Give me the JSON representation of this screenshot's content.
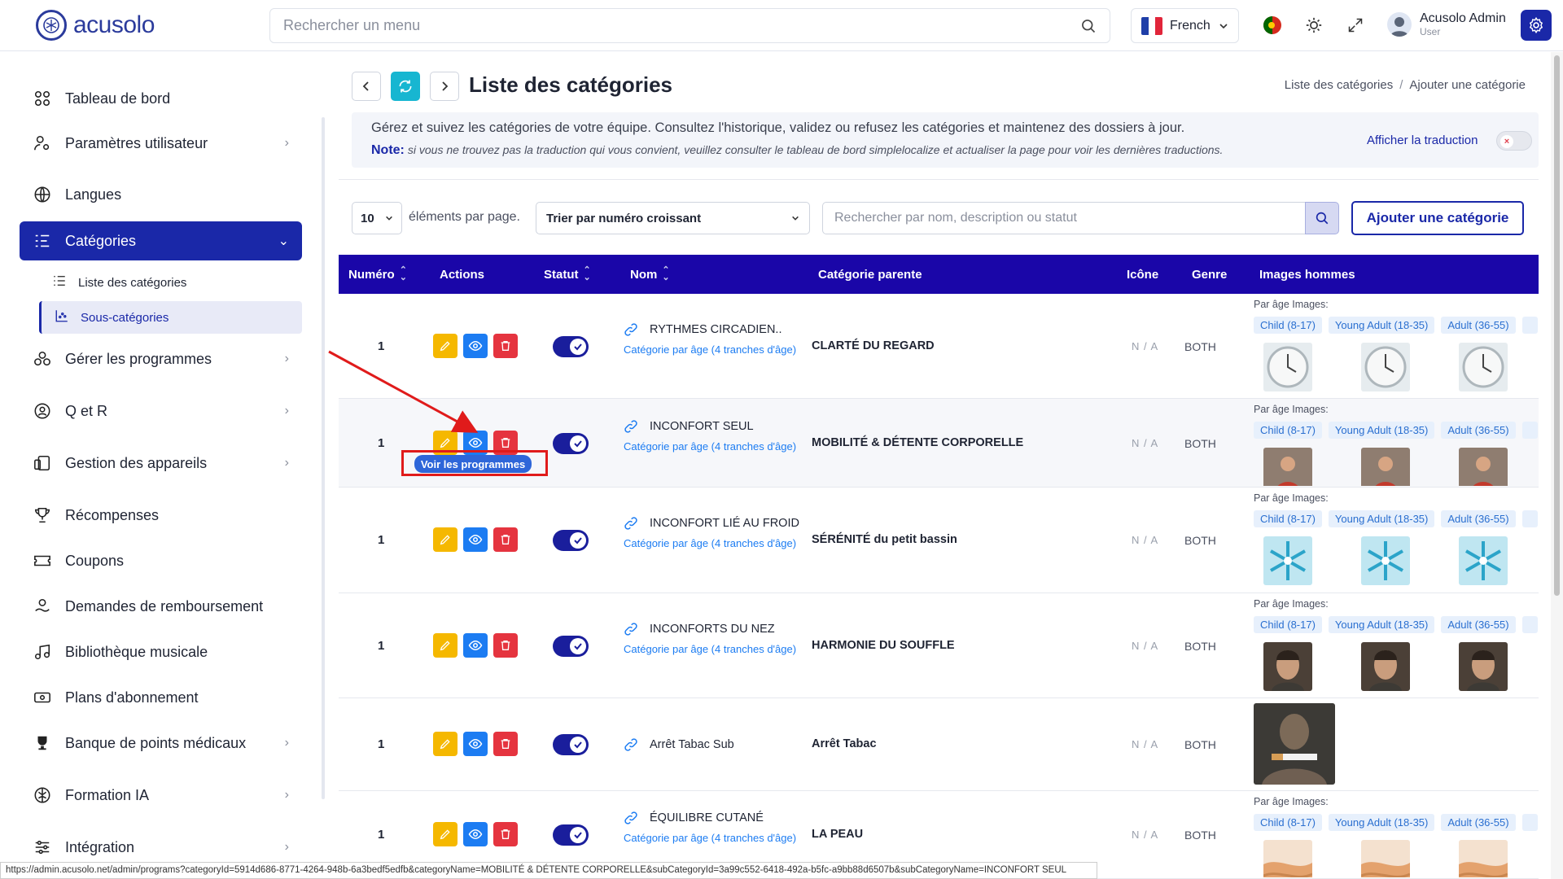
{
  "app": {
    "logo_text": "acusolo"
  },
  "topbar": {
    "search_placeholder": "Rechercher un menu",
    "language": "French",
    "user_name": "Acusolo Admin",
    "user_role": "User"
  },
  "sidebar": {
    "items": [
      {
        "label": "Tableau de bord"
      },
      {
        "label": "Paramètres utilisateur"
      },
      {
        "label": "Langues"
      },
      {
        "label": "Catégories"
      },
      {
        "label": "Gérer les programmes"
      },
      {
        "label": "Q et R"
      },
      {
        "label": "Gestion des appareils"
      },
      {
        "label": "Récompenses"
      },
      {
        "label": "Coupons"
      },
      {
        "label": "Demandes de remboursement"
      },
      {
        "label": "Bibliothèque musicale"
      },
      {
        "label": "Plans d'abonnement"
      },
      {
        "label": "Banque de points médicaux"
      },
      {
        "label": "Formation IA"
      },
      {
        "label": "Intégration"
      }
    ],
    "sub_items": [
      {
        "label": "Liste des catégories"
      },
      {
        "label": "Sous-catégories"
      }
    ]
  },
  "page": {
    "title": "Liste des catégories",
    "breadcrumb": [
      "Liste des catégories",
      "Ajouter une catégorie"
    ],
    "info_text": "Gérez et suivez les catégories de votre équipe. Consultez l'historique, validez ou refusez les catégories et maintenez des dossiers à jour.",
    "note_label": "Note:",
    "note_text": "si vous ne trouvez pas la traduction qui vous convient, veuillez consulter le tableau de bord simplelocalize et actualiser la page pour voir les dernières traductions.",
    "translation_toggle_label": "Afficher la traduction",
    "per_page_value": "10",
    "per_page_label": "éléments par page.",
    "sort_value": "Trier par numéro croissant",
    "search_placeholder": "Rechercher par nom, description ou statut",
    "add_button": "Ajouter une catégorie",
    "tooltip": "Voir les programmes",
    "status_url": "https://admin.acusolo.net/admin/programs?categoryId=5914d686-8771-4264-948b-6a3bedf5edfb&categoryName=MOBILITÉ & DÉTENTE CORPORELLE&subCategoryId=3a99c552-6418-492a-b5fc-a9bb88d6507b&subCategoryName=INCONFORT SEUL"
  },
  "table": {
    "columns": [
      "Numéro",
      "Actions",
      "Statut",
      "Nom",
      "Catégorie parente",
      "Icône",
      "Genre",
      "Images hommes"
    ],
    "age_head": "Par âge Images:",
    "age_tags": [
      "Child (8-17)",
      "Young Adult (18-35)",
      "Adult (36-55)"
    ],
    "link_text": "Catégorie par âge (4 tranches d'âge)",
    "rows": [
      {
        "num": "1",
        "name": "RYTHMES CIRCADIEN..",
        "parent": "CLARTÉ DU REGARD",
        "icon": "N / A",
        "genre": "BOTH",
        "image": "clock"
      },
      {
        "num": "1",
        "name": "INCONFORT SEUL",
        "parent": "MOBILITÉ & DÉTENTE CORPORELLE",
        "icon": "N / A",
        "genre": "BOTH",
        "image": "pain"
      },
      {
        "num": "1",
        "name": "INCONFORT LIÉ AU FROID",
        "parent": "SÉRÉNITÉ du petit bassin",
        "icon": "N / A",
        "genre": "BOTH",
        "image": "snowflake"
      },
      {
        "num": "1",
        "name": "INCONFORTS DU NEZ",
        "parent": "HARMONIE DU SOUFFLE",
        "icon": "N / A",
        "genre": "BOTH",
        "image": "face"
      },
      {
        "num": "1",
        "name": "Arrêt Tabac Sub",
        "parent": "Arrêt Tabac",
        "icon": "N / A",
        "genre": "BOTH",
        "image": "cigarette"
      },
      {
        "num": "1",
        "name": "ÉQUILIBRE CUTANÉ",
        "parent": "LA PEAU",
        "icon": "N / A",
        "genre": "BOTH",
        "image": "skin"
      }
    ]
  },
  "colors": {
    "primary": "#1a28a8",
    "header": "#1a06a8",
    "edit": "#f5b800",
    "view": "#1c7cf2",
    "delete": "#e5343f",
    "refresh": "#17b6d1"
  }
}
